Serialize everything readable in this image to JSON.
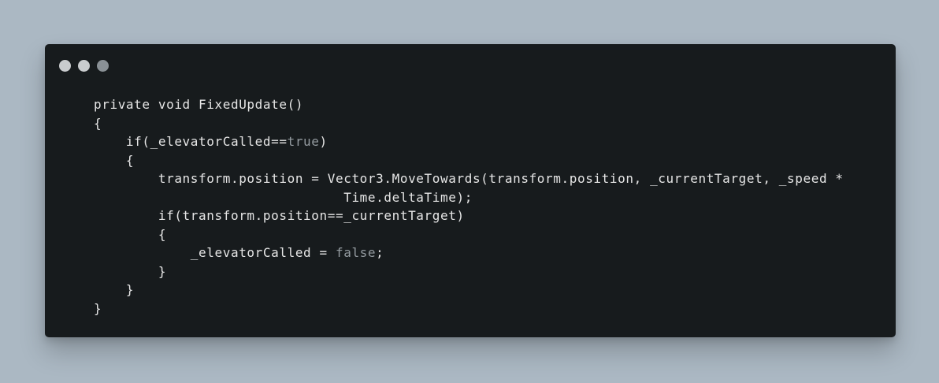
{
  "window": {
    "title_dots": [
      {
        "name": "close-dot",
        "color": "#c9ccce"
      },
      {
        "name": "minimize-dot",
        "color": "#c9ccce"
      },
      {
        "name": "maximize-dot",
        "color": "#8a9196"
      }
    ]
  },
  "code": {
    "language": "csharp",
    "lines": [
      "private void FixedUpdate()",
      "{",
      "    if(_elevatorCalled==true)",
      "    {",
      "        transform.position = Vector3.MoveTowards(transform.position, _currentTarget, _speed *",
      "                               Time.deltaTime);",
      "        if(transform.position==_currentTarget)",
      "        {",
      "            _elevatorCalled = false;",
      "        }",
      "    }",
      "}"
    ]
  },
  "colors": {
    "background": "#abb8c3",
    "editor_background": "#171b1d",
    "text": "#e6e6e6",
    "literal": "#949ba0"
  }
}
